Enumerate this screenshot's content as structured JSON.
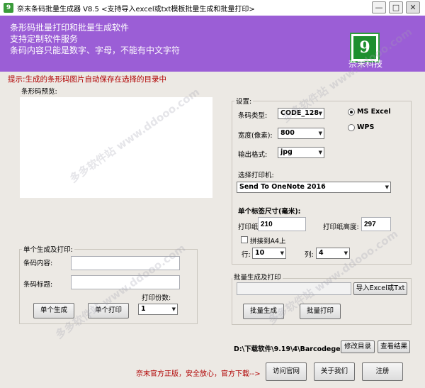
{
  "window": {
    "title": "奈末条码批量生成器 V8.5 <支持导入excel或txt模板批量生成和批量打印>",
    "minimize": "—",
    "maximize": "□",
    "close": "✕"
  },
  "banner": {
    "lines": [
      "条形码批量打印和批量生成软件",
      "支持定制软件服务",
      "条码内容只能是数字、字母，不能有中文字符"
    ],
    "logo_glyph": "9",
    "company": "奈末科技"
  },
  "notice": "提示:生成的条形码图片自动保存在选择的目录中",
  "preview": {
    "label": "条形码预览:"
  },
  "single": {
    "title": "单个生成及打印:",
    "content_label": "条码内容:",
    "content_value": "",
    "caption_label": "条码标题:",
    "caption_value": "",
    "copies_label": "打印份数:",
    "copies_value": "1",
    "generate_button": "单个生成",
    "print_button": "单个打印"
  },
  "settings": {
    "title": "设置:",
    "type_label": "条码类型:",
    "type_value": "CODE_128",
    "width_label": "宽度(像素):",
    "width_value": "800",
    "format_label": "输出格式:",
    "format_value": "jpg",
    "radio_ms_excel": "MS Excel",
    "radio_wps": "WPS",
    "printer_label": "选择打印机:",
    "printer_value": "Send To OneNote 2016",
    "label_size_title": "单个标签尺寸(毫米):",
    "paper_width_label": "打印纸宽度:",
    "paper_width_value": "210",
    "paper_height_label": "打印纸高度:",
    "paper_height_value": "297",
    "a4_checkbox": "拼接到A4上",
    "rows_label": "行:",
    "rows_value": "10",
    "cols_label": "列:",
    "cols_value": "4"
  },
  "batch": {
    "title": "批量生成及打印",
    "file_value": "",
    "import_button": "导入Excel或Txt",
    "generate_button": "批量生成",
    "print_button": "批量打印"
  },
  "output": {
    "path": "D:\\下载软件\\9.19\\4\\Barcodege",
    "change_dir_button": "修改目录",
    "view_result_button": "查看结果"
  },
  "footer": {
    "promo": "奈末官方正版，安全放心，官方下载-->",
    "website_button": "访问官网",
    "about_button": "关于我们",
    "register_button": "注册"
  },
  "watermark": "多多软件站 www.ddooo.com"
}
